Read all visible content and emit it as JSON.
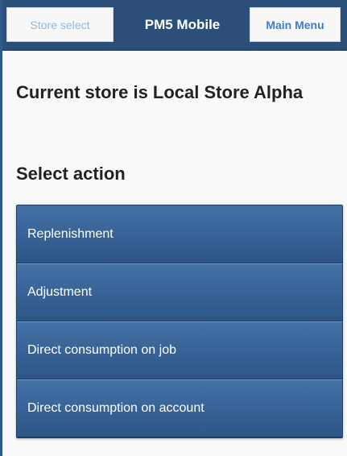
{
  "header": {
    "store_select_label": "Store select",
    "title": "PM5 Mobile",
    "main_menu_label": "Main Menu"
  },
  "main": {
    "current_store_text": "Current store is Local Store Alpha",
    "select_action_heading": "Select action",
    "actions": [
      {
        "label": "Replenishment"
      },
      {
        "label": "Adjustment"
      },
      {
        "label": "Direct consumption on job"
      },
      {
        "label": "Direct consumption on account"
      }
    ]
  },
  "colors": {
    "header_bg": "#2b4f78",
    "button_accent": "#3f7fc6",
    "list_item_bg": "#3a6699"
  }
}
